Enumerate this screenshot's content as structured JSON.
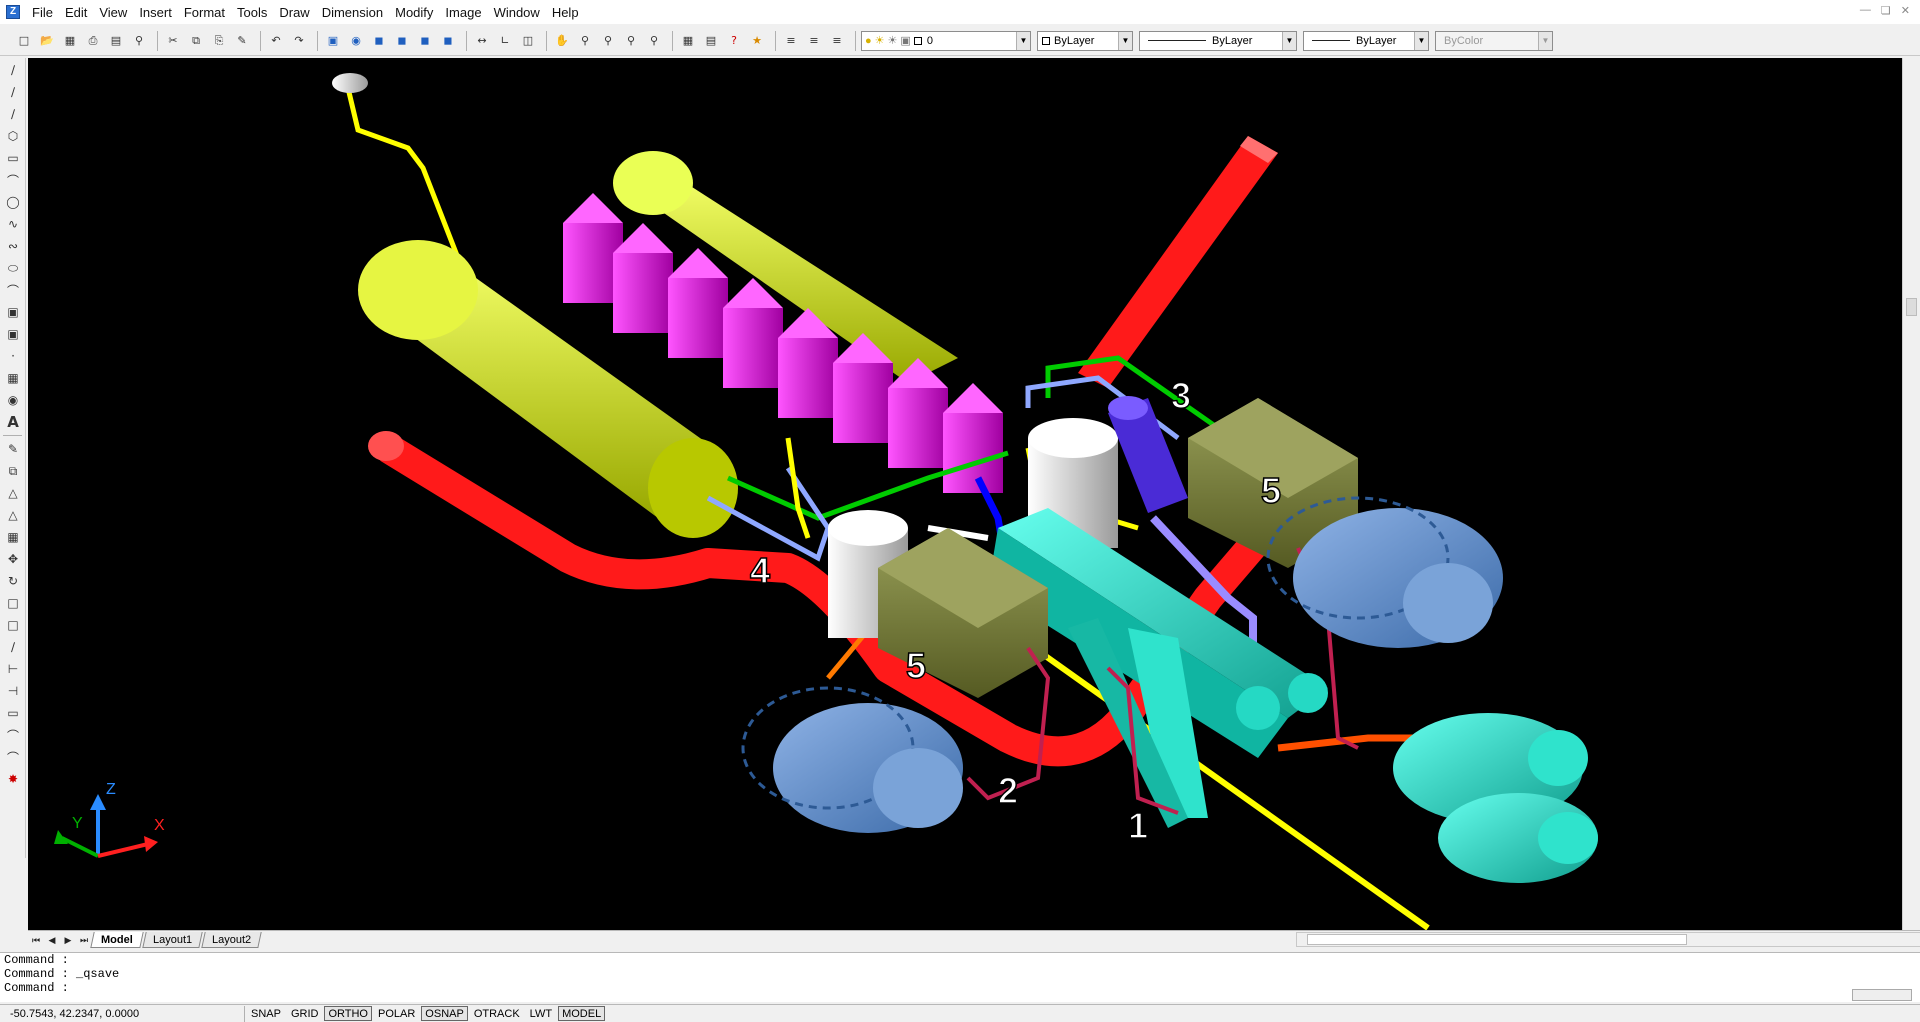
{
  "menubar": {
    "app_icon_glyph": "Z",
    "items": [
      "File",
      "Edit",
      "View",
      "Insert",
      "Format",
      "Tools",
      "Draw",
      "Dimension",
      "Modify",
      "Image",
      "Window",
      "Help"
    ]
  },
  "toolbar": {
    "layer_value": "0",
    "color_value": "ByLayer",
    "linetype_value": "ByLayer",
    "lineweight_value": "ByLayer",
    "plotstyle_value": "ByColor"
  },
  "viewport": {
    "background": "#000000",
    "callouts": [
      "1",
      "2",
      "3",
      "4",
      "5",
      "5"
    ],
    "ucs": {
      "x": "X",
      "y": "Y",
      "z": "Z"
    }
  },
  "tabs": {
    "items": [
      "Model",
      "Layout1",
      "Layout2"
    ],
    "active": "Model"
  },
  "command": {
    "lines": [
      "Command :",
      "Command :  _qsave",
      "Command :"
    ]
  },
  "status": {
    "coords": "-50.7543, 42.2347, 0.0000",
    "buttons": [
      {
        "label": "SNAP",
        "on": false
      },
      {
        "label": "GRID",
        "on": false
      },
      {
        "label": "ORTHO",
        "on": true
      },
      {
        "label": "POLAR",
        "on": false
      },
      {
        "label": "OSNAP",
        "on": true
      },
      {
        "label": "OTRACK",
        "on": false
      },
      {
        "label": "LWT",
        "on": false
      },
      {
        "label": "MODEL",
        "on": true
      }
    ]
  }
}
